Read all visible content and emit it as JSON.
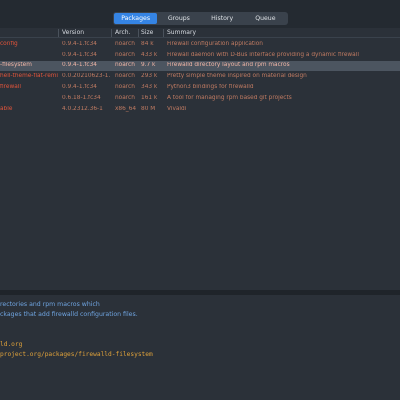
{
  "tabs": [
    "Packages",
    "Groups",
    "History",
    "Queue"
  ],
  "active_tab": "Packages",
  "columns": {
    "name": "",
    "version": "Version",
    "arch": "Arch.",
    "size": "Size",
    "summary": "Summary"
  },
  "packages": [
    {
      "name": "config",
      "version": "0.9.4-1.fc34",
      "arch": "noarch",
      "size": "84 k",
      "summary": "Firewall configuration application",
      "selected": false
    },
    {
      "name": "",
      "version": "0.9.4-1.fc34",
      "arch": "noarch",
      "size": "433 k",
      "summary": "Firewall daemon with D-Bus interface providing a dynamic firewall",
      "selected": false
    },
    {
      "name": "-filesystem",
      "version": "0.9.4-1.fc34",
      "arch": "noarch",
      "size": "9.7 k",
      "summary": "Firewalld directory layout and rpm macros",
      "selected": true
    },
    {
      "name": "hell-theme-flat-remi",
      "version": "0.0.20210623-1.fc",
      "arch": "noarch",
      "size": "293 k",
      "summary": "Pretty simple theme inspired on material design",
      "selected": false
    },
    {
      "name": "firewall",
      "version": "0.9.4-1.fc34",
      "arch": "noarch",
      "size": "343 k",
      "summary": "Python3 bindings for firewalld",
      "selected": false
    },
    {
      "name": "",
      "version": "0.6.18-1.fc34",
      "arch": "noarch",
      "size": "161 k",
      "summary": "A tool for managing rpm based git projects",
      "selected": false
    },
    {
      "name": "able",
      "version": "4.0.2312.36-1",
      "arch": "x86_64",
      "size": "80 M",
      "summary": "Vivaldi",
      "selected": false
    }
  ],
  "info": {
    "description_lines": [
      "rectories and rpm macros which",
      "ckages that add firewalld configuration files."
    ],
    "link_lines": [
      "ld.org",
      "project.org/packages/firewalld-filesystem"
    ]
  },
  "colors": {
    "accent": "#3584e4",
    "package_text": "#e2543a",
    "description": "#6fa4e0",
    "link": "#e0a23a"
  }
}
